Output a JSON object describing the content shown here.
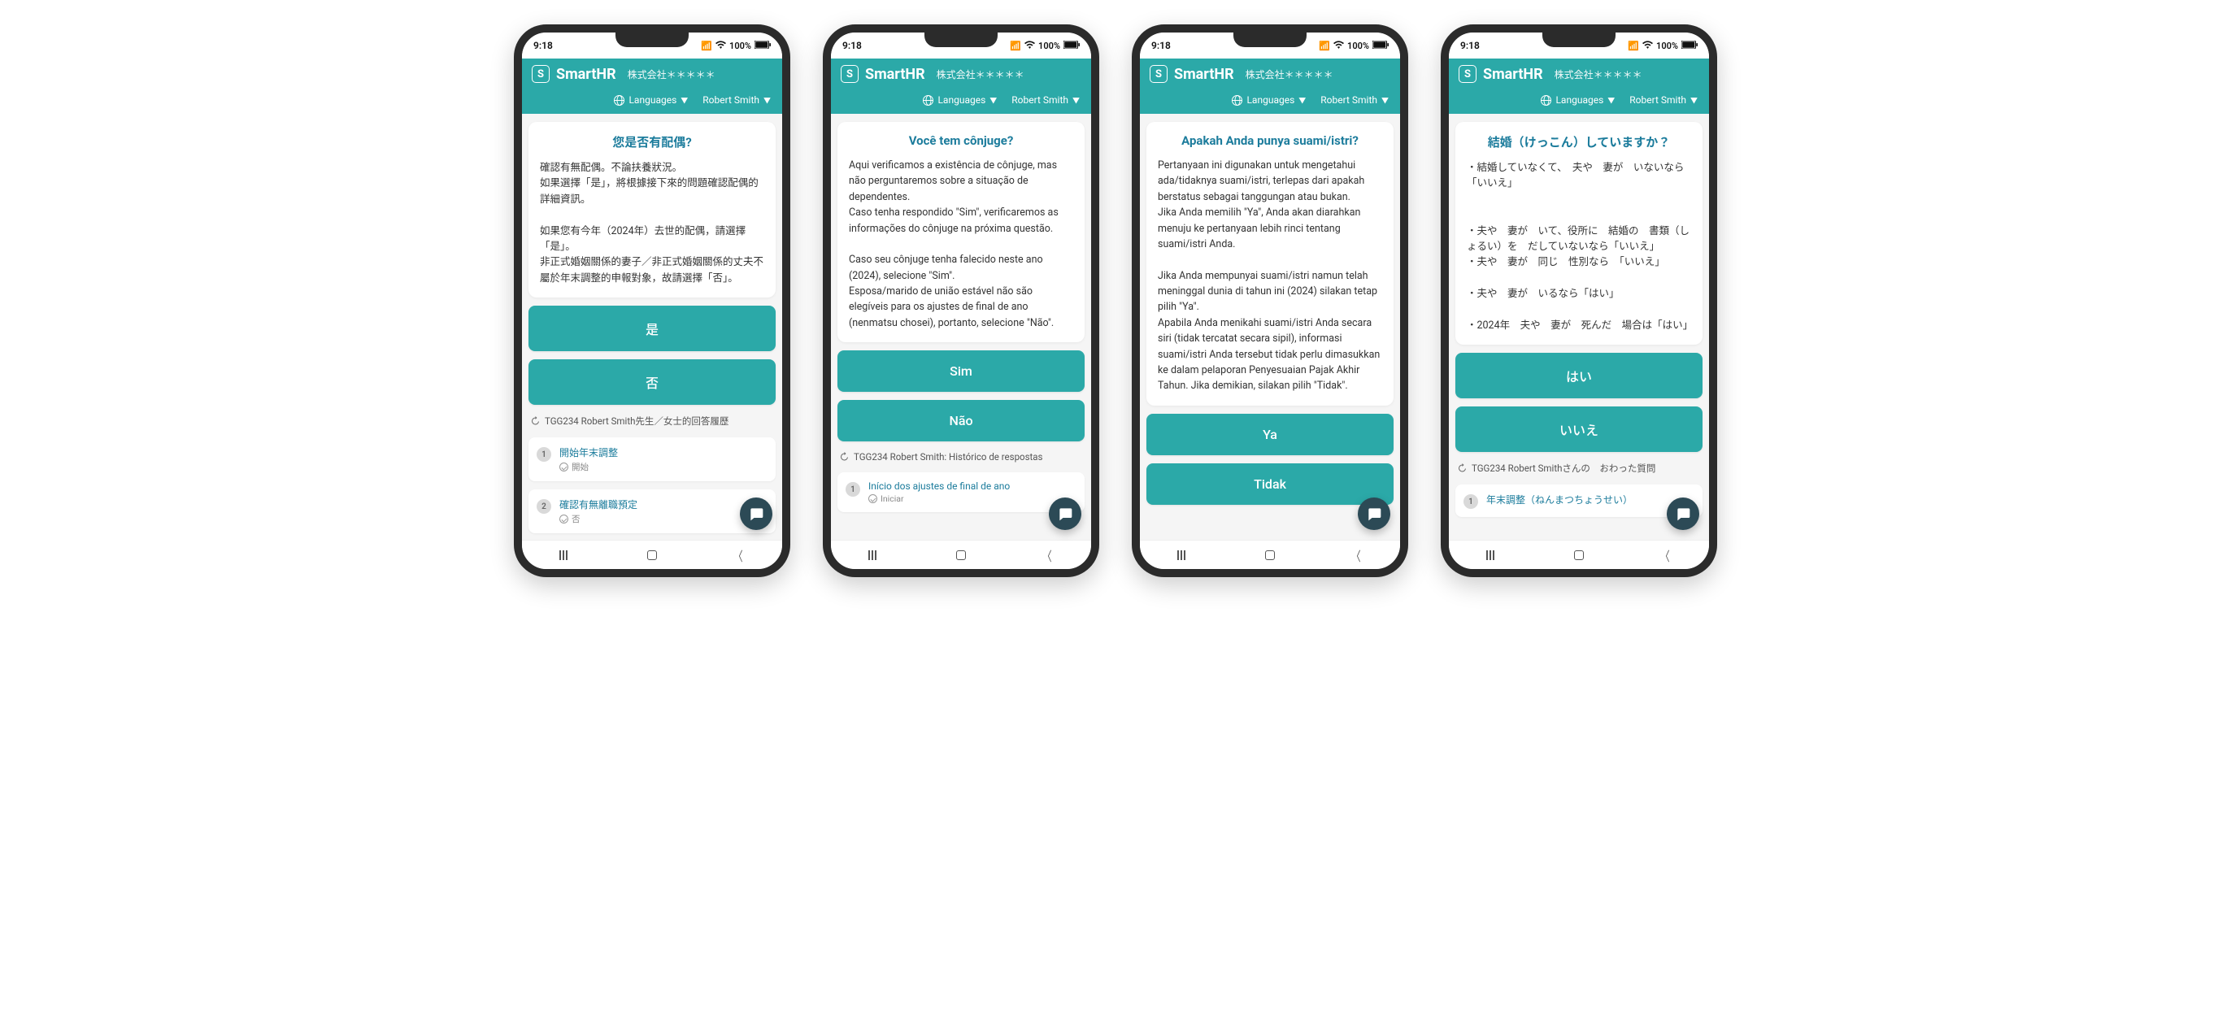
{
  "status": {
    "time": "9:18",
    "battery": "100%"
  },
  "header": {
    "brand": "SmartHR",
    "company": "株式会社＊＊＊＊＊",
    "languages_label": "Languages",
    "user": "Robert Smith"
  },
  "phones": [
    {
      "question_title": "您是否有配偶?",
      "question_body": "確認有無配偶。不論扶養狀況。\n如果選擇「是」，將根據接下來的問題確認配偶的詳細資訊。\n\n如果您有今年（2024年）去世的配偶，請選擇「是」。\n非正式婚姻關係的妻子／非正式婚姻關係的丈夫不屬於年末調整的申報對象，故請選擇「否」。",
      "btn_yes": "是",
      "btn_no": "否",
      "history_label": "TGG234 Robert Smith先生／女士的回答履歷",
      "history_items": [
        {
          "num": "1",
          "title": "開始年末調整",
          "sub": "開始"
        },
        {
          "num": "2",
          "title": "確認有無離職預定",
          "sub": "否"
        }
      ]
    },
    {
      "question_title": "Você tem cônjuge?",
      "question_body": "Aqui verificamos a existência de cônjuge, mas não perguntaremos sobre a situação de dependentes.\nCaso tenha respondido \"Sim\", verificaremos as informações do cônjuge na próxima questão.\n\nCaso seu cônjuge tenha falecido neste ano (2024), selecione \"Sim\".\nEsposa/marido de união estável não são elegíveis para os ajustes de final de ano (nenmatsu chosei), portanto, selecione \"Não\".",
      "btn_yes": "Sim",
      "btn_no": "Não",
      "history_label": "TGG234 Robert Smith: Histórico de respostas",
      "history_items": [
        {
          "num": "1",
          "title": "Início dos ajustes de final de ano",
          "sub": "Iniciar"
        }
      ]
    },
    {
      "question_title": "Apakah Anda punya suami/istri?",
      "question_body": "Pertanyaan ini digunakan untuk mengetahui ada/tidaknya suami/istri, terlepas dari apakah berstatus sebagai tanggungan atau bukan.\nJika Anda memilih \"Ya\", Anda akan diarahkan menuju ke pertanyaan lebih rinci tentang suami/istri Anda.\n\nJika Anda mempunyai suami/istri namun telah meninggal dunia di tahun ini (2024) silakan tetap pilih \"Ya\".\nApabila Anda menikahi suami/istri Anda secara siri (tidak tercatat secara sipil), informasi suami/istri Anda tersebut tidak perlu dimasukkan ke dalam pelaporan Penyesuaian Pajak Akhir Tahun. Jika demikian, silakan pilih \"Tidak\".",
      "btn_yes": "Ya",
      "btn_no": "Tidak",
      "history_label": "",
      "history_items": []
    },
    {
      "question_title": "結婚（けっこん）していますか？",
      "question_body": "・結婚していなくて、　夫や　妻が　いないなら「いいえ」\n\n\n・夫や　妻が　いて、役所に　結婚の　書類（しょるい）を　だしていないなら「いいえ」\n・夫や　妻が　同じ　性別なら　「いいえ」\n\n・夫や　妻が　いるなら「はい」\n\n・2024年　夫や　妻が　死んだ　場合は「はい」",
      "btn_yes": "はい",
      "btn_no": "いいえ",
      "history_label": "TGG234 Robert Smithさんの　おわった質問",
      "history_items": [
        {
          "num": "1",
          "title": "年末調整（ねんまつちょうせい）",
          "sub": ""
        }
      ]
    }
  ]
}
